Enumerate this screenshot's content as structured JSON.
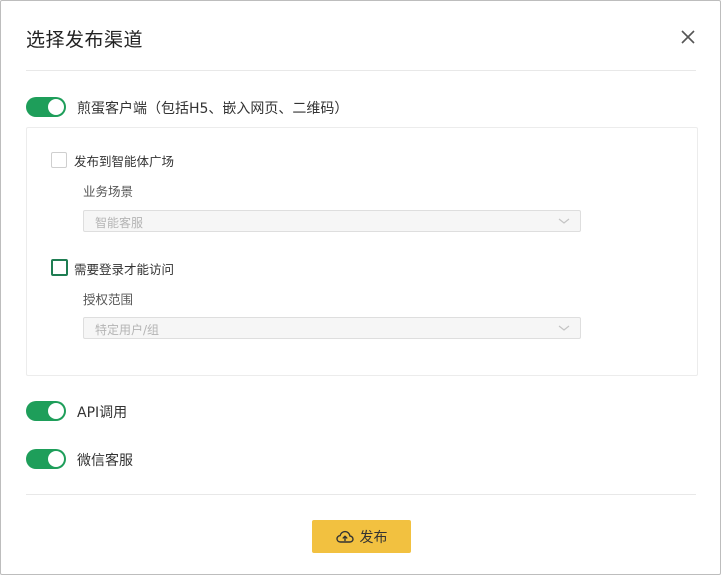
{
  "dialog": {
    "title": "选择发布渠道",
    "close_icon": "close-icon"
  },
  "channels": {
    "client": {
      "label": "煎蛋客户端（包括H5、嵌入网页、二维码）",
      "enabled": true
    },
    "api": {
      "label": "API调用",
      "enabled": true
    },
    "wechat": {
      "label": "微信客服",
      "enabled": true
    }
  },
  "client_options": {
    "publish_square": {
      "label": "发布到智能体广场",
      "checked": false
    },
    "business_scene": {
      "label": "业务场景",
      "placeholder": "智能客服"
    },
    "require_login": {
      "label": "需要登录才能访问",
      "checked": false
    },
    "auth_scope": {
      "label": "授权范围",
      "placeholder": "特定用户/组"
    }
  },
  "footer": {
    "publish_label": "发布",
    "publish_icon": "cloud-upload-icon"
  },
  "colors": {
    "toggle_on": "#1e9e5a",
    "publish_button": "#f2c140"
  }
}
